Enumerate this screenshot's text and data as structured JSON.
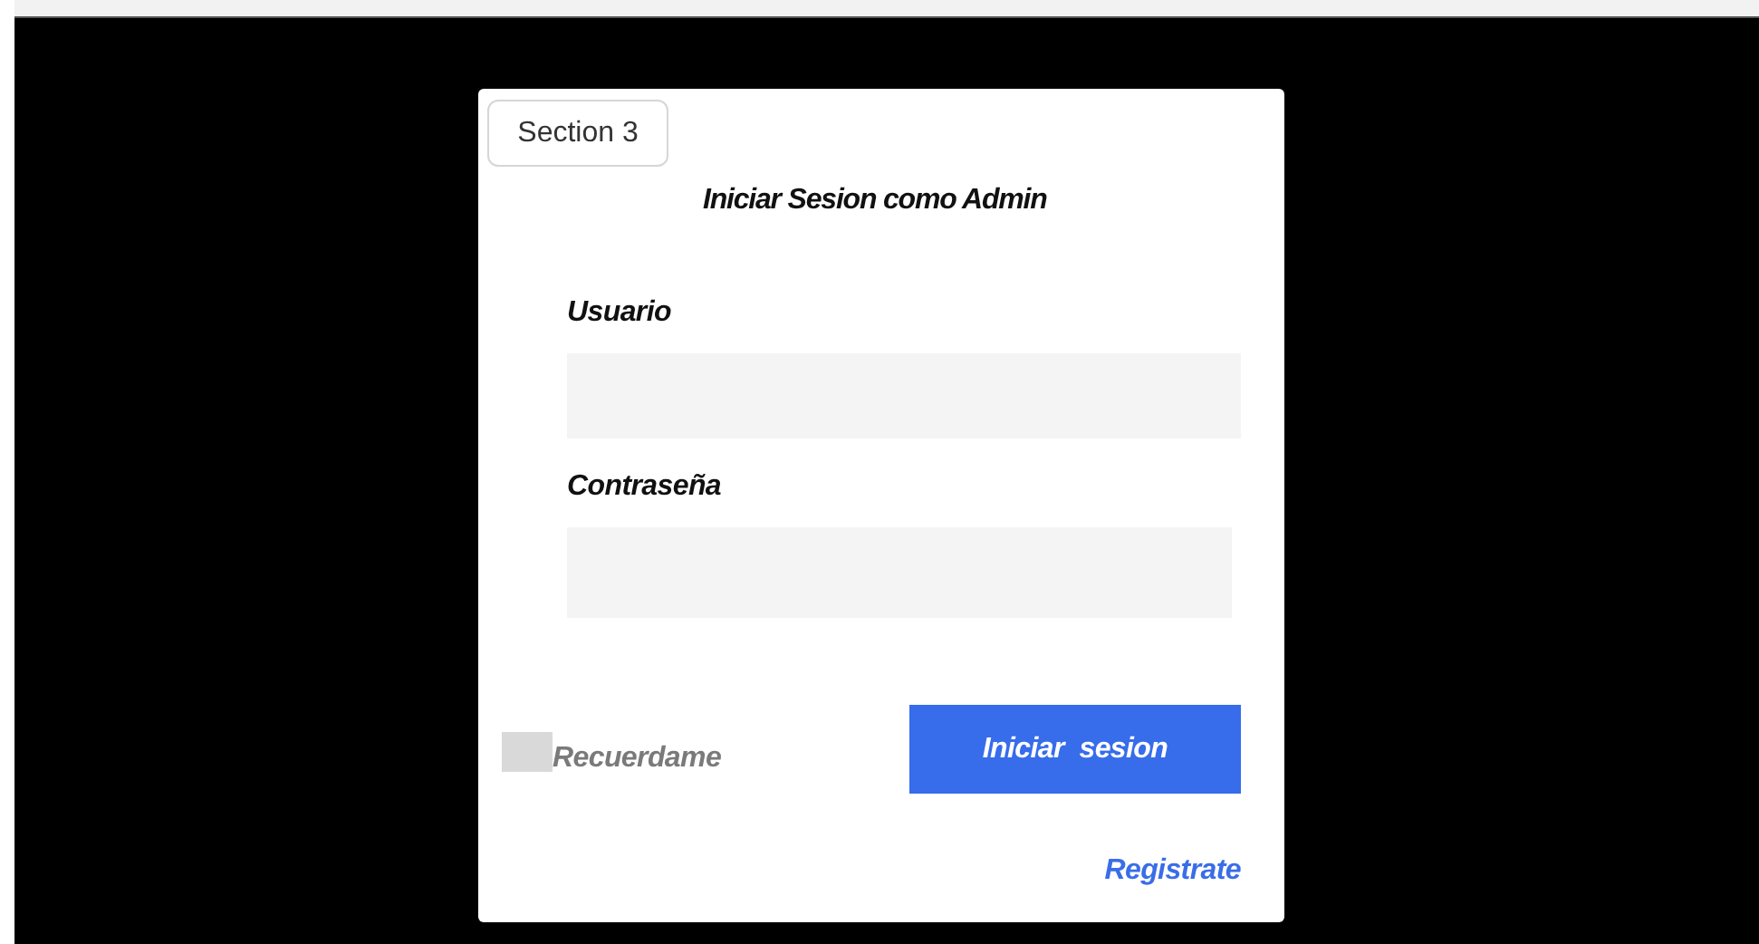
{
  "section_tag": "Section 3",
  "title": "Iniciar  Sesion como Admin",
  "fields": [
    {
      "label": "Usuario"
    },
    {
      "label": "Contraseña"
    }
  ],
  "remember": {
    "label": "Recuerdame",
    "checked": false
  },
  "submit_button": "Iniciar  sesion",
  "register_link": "Registrate"
}
